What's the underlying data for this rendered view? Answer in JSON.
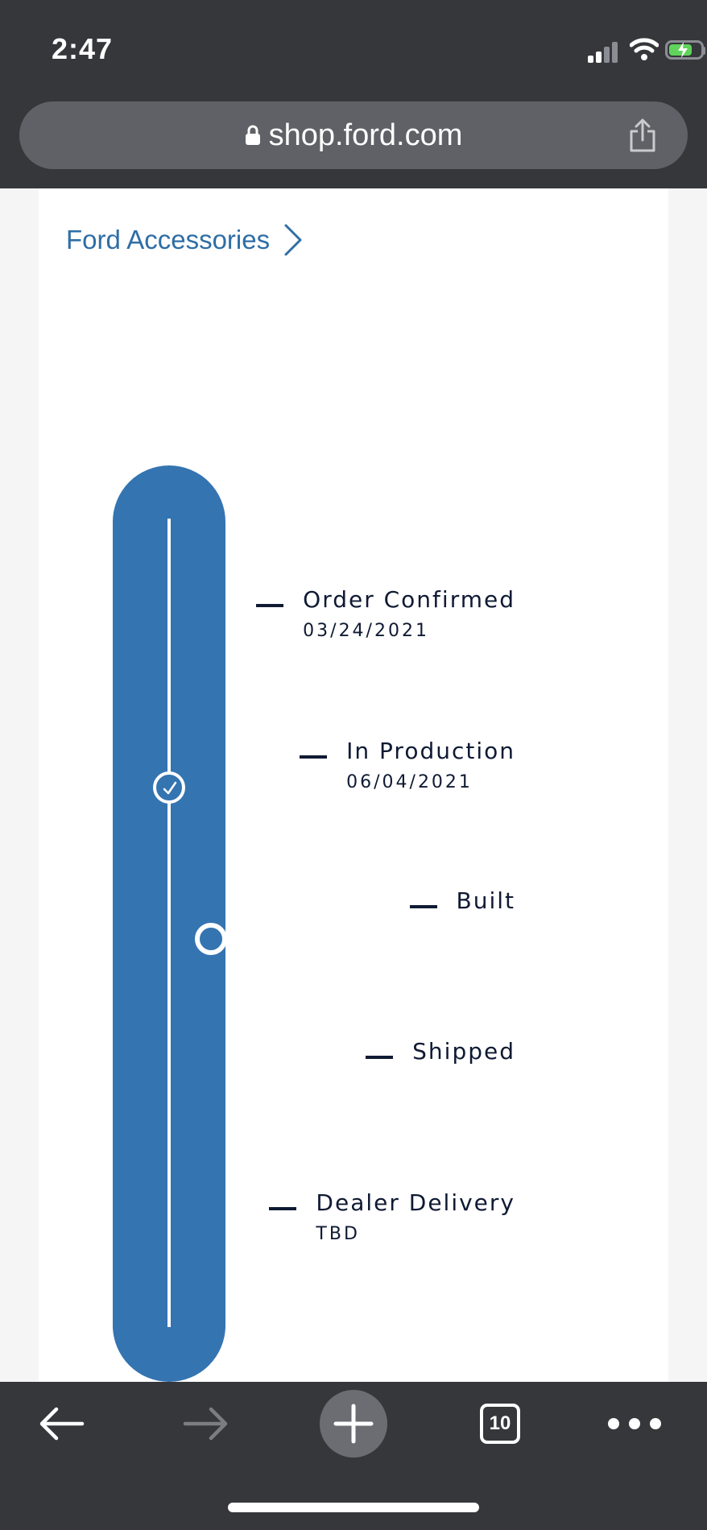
{
  "status_bar": {
    "time": "2:47"
  },
  "browser": {
    "url": "shop.ford.com",
    "open_tabs": "10"
  },
  "breadcrumb": {
    "label": "Ford Accessories"
  },
  "tracker": {
    "steps": [
      {
        "name": "Order Confirmed",
        "date": "03/24/2021",
        "state": "complete"
      },
      {
        "name": "In Production",
        "date": "06/04/2021",
        "state": "current"
      },
      {
        "name": "Built",
        "date": "",
        "state": "pending"
      },
      {
        "name": "Shipped",
        "date": "",
        "state": "pending"
      },
      {
        "name": "Dealer Delivery",
        "date": "TBD",
        "state": "pending"
      }
    ]
  },
  "colors": {
    "chrome_dark": "#36373b",
    "tracker_blue": "#3474b1",
    "link_blue": "#2f6ea6",
    "text_navy": "#0f1a33",
    "battery_green": "#5fd35b"
  },
  "icons": {
    "lock": "lock-icon",
    "share": "share-icon",
    "chevron": "chevron-right-icon",
    "back": "back-arrow-icon",
    "forward": "forward-arrow-icon",
    "new_tab": "plus-icon",
    "tabs": "tabs-icon",
    "more": "more-icon"
  }
}
